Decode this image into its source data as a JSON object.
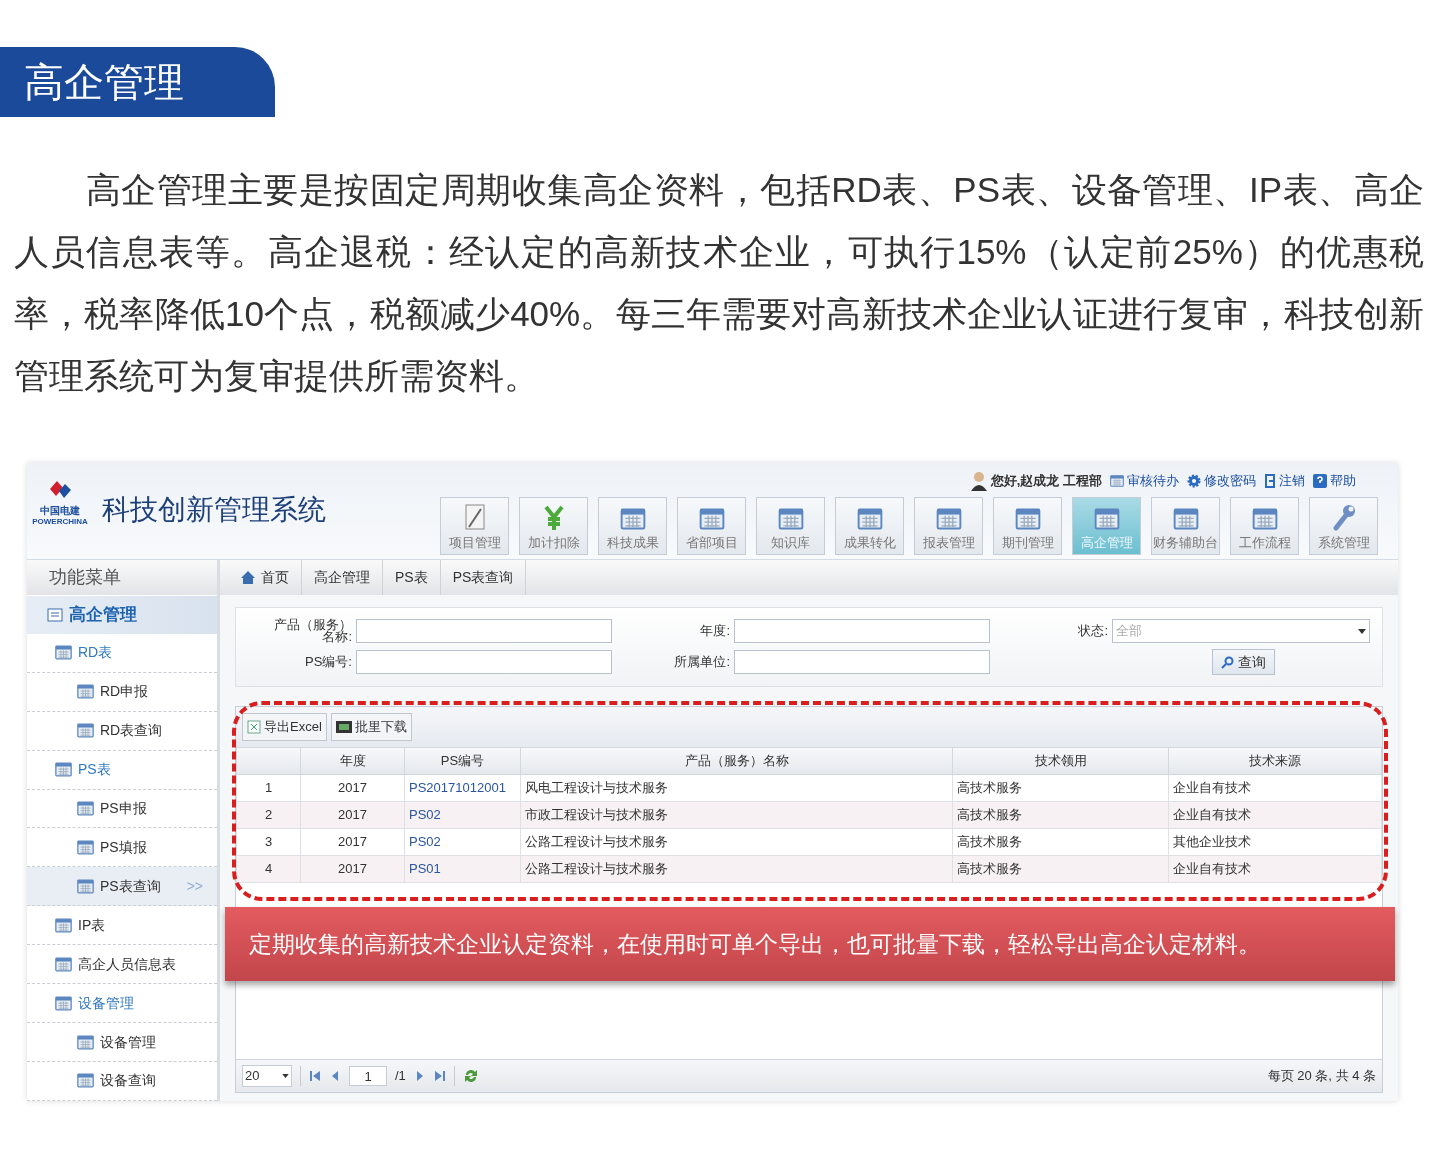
{
  "heading": "高企管理",
  "intro": "高企管理主要是按固定周期收集高企资料，包括RD表、PS表、设备管理、IP表、高企人员信息表等。高企退税：经认定的高新技术企业，可执行15%（认定前25%）的优惠税率，税率降低10个点，税额减少40%。每三年需要对高新技术企业认证进行复审，科技创新管理系统可为复审提供所需资料。",
  "app": {
    "logo_text": "中国电建",
    "logo_subtext": "POWERCHINA",
    "system_title": "科技创新管理系统",
    "user_bar": [
      {
        "kind": "user",
        "label": "您好,赵成龙 工程部"
      },
      {
        "kind": "todo",
        "label": "审核待办"
      },
      {
        "kind": "password",
        "label": "修改密码"
      },
      {
        "kind": "logout",
        "label": "注销"
      },
      {
        "kind": "help",
        "label": "帮助"
      }
    ],
    "nav": [
      {
        "label": "项目管理",
        "kind": "pen",
        "selected": false
      },
      {
        "label": "加计扣除",
        "kind": "yen",
        "selected": false
      },
      {
        "label": "科技成果",
        "kind": "grid",
        "selected": false
      },
      {
        "label": "省部项目",
        "kind": "grid",
        "selected": false
      },
      {
        "label": "知识库",
        "kind": "grid",
        "selected": false
      },
      {
        "label": "成果转化",
        "kind": "grid",
        "selected": false
      },
      {
        "label": "报表管理",
        "kind": "grid",
        "selected": false
      },
      {
        "label": "期刊管理",
        "kind": "grid",
        "selected": false
      },
      {
        "label": "高企管理",
        "kind": "grid",
        "selected": true
      },
      {
        "label": "财务辅助台",
        "kind": "grid",
        "selected": false
      },
      {
        "label": "工作流程",
        "kind": "grid",
        "selected": false
      },
      {
        "label": "系统管理",
        "kind": "wrench",
        "selected": false
      }
    ],
    "sidebar": {
      "title": "功能菜单",
      "section": "高企管理",
      "items": [
        {
          "label": "RD表",
          "selected": false,
          "children": [
            {
              "label": "RD申报",
              "selected": false
            },
            {
              "label": "RD表查询",
              "selected": false
            }
          ]
        },
        {
          "label": "PS表",
          "selected": false,
          "children": [
            {
              "label": "PS申报",
              "selected": false
            },
            {
              "label": "PS填报",
              "selected": false
            },
            {
              "label": "PS表查询",
              "selected": true,
              "marker": ">>"
            }
          ]
        },
        {
          "label": "IP表",
          "selected": false
        },
        {
          "label": "高企人员信息表",
          "selected": false
        },
        {
          "label": "设备管理",
          "selected": false,
          "children": [
            {
              "label": "设备管理",
              "selected": false
            },
            {
              "label": "设备查询",
              "selected": false
            }
          ]
        }
      ]
    },
    "breadcrumb": [
      "首页",
      "高企管理",
      "PS表",
      "PS表查询"
    ],
    "filters": [
      {
        "label": "产品（服务）名称:",
        "kind": "text"
      },
      {
        "label": "年度:",
        "kind": "text"
      },
      {
        "label": "状态:",
        "kind": "select",
        "placeholder": "全部"
      },
      {
        "label": "PS编号:",
        "kind": "text"
      },
      {
        "label": "所属单位:",
        "kind": "text"
      }
    ],
    "search_button": "查询",
    "toolbar": [
      {
        "kind": "excel",
        "label": "导出Excel"
      },
      {
        "kind": "download",
        "label": "批里下载"
      }
    ],
    "table": {
      "columns": [
        "",
        "年度",
        "PS编号",
        "产品（服务）名称",
        "技术领用",
        "技术来源"
      ],
      "rows": [
        [
          "1",
          "2017",
          "PS20171012001",
          "风电工程设计与技术服务",
          "高技术服务",
          "企业自有技术"
        ],
        [
          "2",
          "2017",
          "PS02",
          "市政工程设计与技术服务",
          "高技术服务",
          "企业自有技术"
        ],
        [
          "3",
          "2017",
          "PS02",
          "公路工程设计与技术服务",
          "高技术服务",
          "其他企业技术"
        ],
        [
          "4",
          "2017",
          "PS01",
          "公路工程设计与技术服务",
          "高技术服务",
          "企业自有技术"
        ]
      ]
    },
    "pager": {
      "page_size": "20",
      "page": "1",
      "total_pages": "/1",
      "summary": "每页 20 条, 共 4 条"
    },
    "callout": "定期收集的高新技术企业认定资料，在使用时可单个导出，也可批量下载，轻松导出高企认定材料。"
  }
}
